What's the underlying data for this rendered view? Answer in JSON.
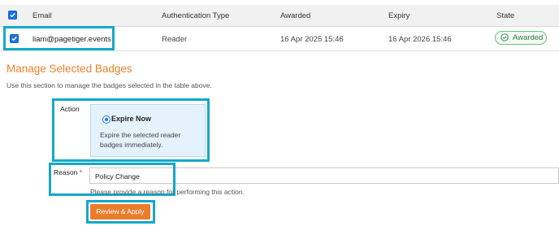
{
  "table": {
    "headers": {
      "email": "Email",
      "auth_type": "Authentication Type",
      "awarded": "Awarded",
      "expiry": "Expiry",
      "state": "State"
    },
    "rows": [
      {
        "selected": true,
        "email": "liam@pagetiger.events",
        "auth_type": "Reader",
        "awarded": "16 Apr 2025 15:46",
        "expiry": "16 Apr 2026 15:46",
        "state": "Awarded"
      }
    ]
  },
  "manage": {
    "title": "Manage Selected Badges",
    "description": "Use this section to manage the badges selected in the table above.",
    "action_label": "Action",
    "option": {
      "title": "Expire Now",
      "description": "Expire the selected reader badges immediately."
    },
    "reason_label": "Reason",
    "required_marker": "*",
    "reason_value": "Policy Change",
    "reason_help": "Please provide a reason for performing this action.",
    "submit_label": "Review & Apply"
  },
  "colors": {
    "accent_orange": "#ea7d2c",
    "highlight": "#12a9c9",
    "checkbox_blue": "#1a73e8",
    "status_green": "#2e7d3e"
  },
  "icons": {
    "select_all": "checkbox-checked-icon",
    "row_select": "checkbox-checked-icon",
    "state": "check-circle-icon",
    "action_option": "radio-selected-icon"
  }
}
